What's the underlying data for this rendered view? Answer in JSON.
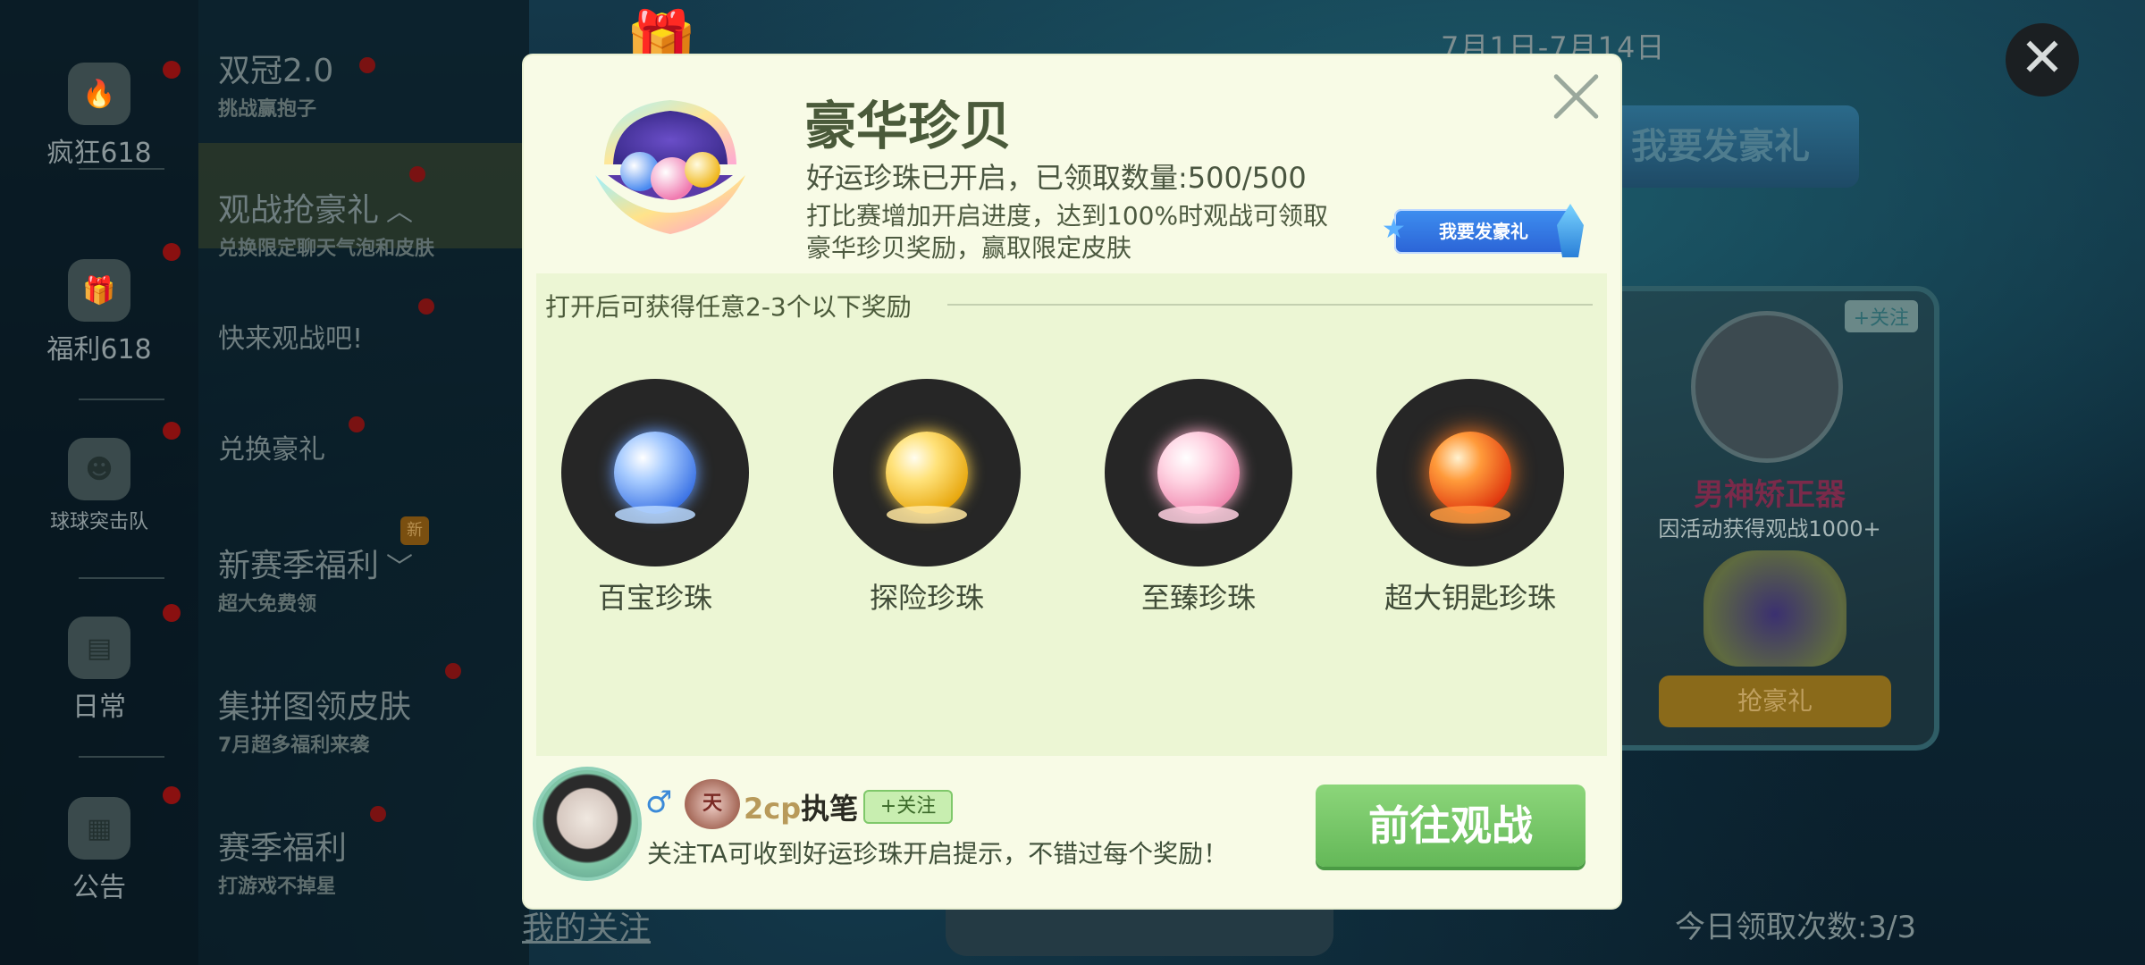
{
  "background": {
    "event_dates": "7月1日-7月14日",
    "send_gift_button": "我要发豪礼",
    "bottom_link": "我的关注",
    "daily_count": "今日领取次数:3/3",
    "right_panel": {
      "follow": "+关注",
      "name": "男神矫正器",
      "sub": "因活动获得观战1000+",
      "button": "抢豪礼"
    }
  },
  "left_rail": {
    "items": [
      {
        "label": "疯狂618",
        "icon": "flame-618-icon"
      },
      {
        "label": "福利618",
        "icon": "gift-618-icon"
      },
      {
        "label": "球球突击队",
        "icon": "squad-icon"
      },
      {
        "label": "日常",
        "icon": "calendar-icon"
      },
      {
        "label": "公告",
        "icon": "notice-icon"
      }
    ]
  },
  "sub_menu": {
    "items": [
      {
        "title": "双冠2.0",
        "subtitle": "挑战赢抱子"
      },
      {
        "title": "观战抢豪礼",
        "subtitle": "兑换限定聊天气泡和皮肤"
      },
      {
        "title": "快来观战吧!",
        "subtitle": ""
      },
      {
        "title": "兑换豪礼",
        "subtitle": ""
      },
      {
        "title": "新赛季福利",
        "subtitle": "超大免费领",
        "badge": "新"
      },
      {
        "title": "集拼图领皮肤",
        "subtitle": "7月超多福利来袭"
      },
      {
        "title": "赛季福利",
        "subtitle": "打游戏不掉星"
      }
    ]
  },
  "modal": {
    "title": "豪华珍贝",
    "status": "好运珍珠已开启，已领取数量:500/500",
    "description": "打比赛增加开启进度，达到100%时观战可领取豪华珍贝奖励，赢取限定皮肤",
    "send_gift_button": "我要发豪礼",
    "rewards_header": "打开后可获得任意2-3个以下奖励",
    "rewards": [
      {
        "name": "百宝珍珠",
        "color": "#7fb4ff"
      },
      {
        "name": "探险珍珠",
        "color": "#ffd24a"
      },
      {
        "name": "至臻珍珠",
        "color": "#ffc6d8"
      },
      {
        "name": "超大钥匙珍珠",
        "color": "#ff5a1e"
      }
    ],
    "streamer": {
      "gender_symbol": "♂",
      "rank": "天",
      "name_prefix": "2cp",
      "name": "执笔",
      "follow_button": "+关注",
      "tip": "关注TA可收到好运珍珠开启提示，不错过每个奖励！"
    },
    "cta_button": "前往观战"
  },
  "close_icon": "close-icon"
}
